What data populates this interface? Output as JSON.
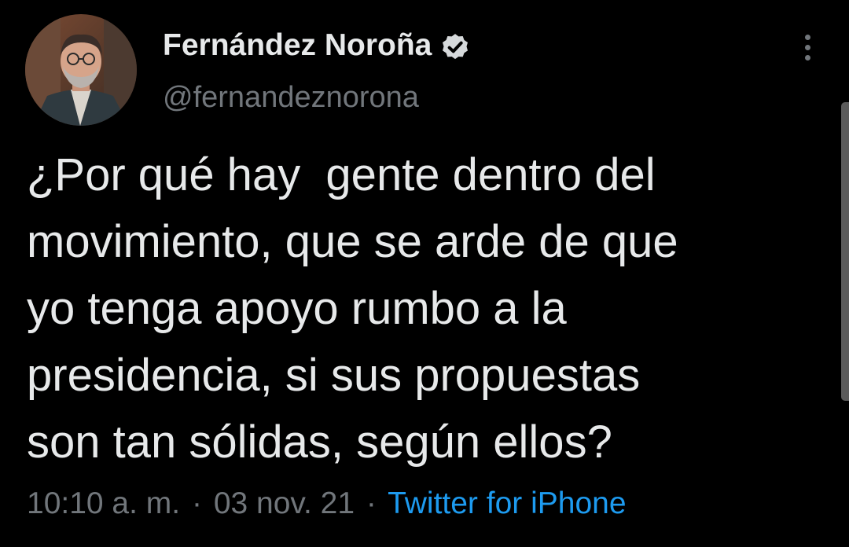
{
  "author": {
    "display_name": "Fernández Noroña",
    "handle": "@fernandeznorona",
    "verified": true,
    "avatar_icon": "profile-photo"
  },
  "tweet": {
    "text": "¿Por qué hay  gente dentro del\nmovimiento, que se arde de que\nyo tenga apoyo rumbo a la\npresidencia, si sus propuestas\nson tan sólidas, según ellos?",
    "time": "10:10 a. m.",
    "separator": "·",
    "date": "03 nov. 21",
    "source": "Twitter for iPhone"
  },
  "menu": {
    "icon": "more-vertical-icon"
  },
  "colors": {
    "background": "#000000",
    "primary_text": "#e7e9ea",
    "secondary_text": "#71767b",
    "link": "#1d9bf0"
  }
}
